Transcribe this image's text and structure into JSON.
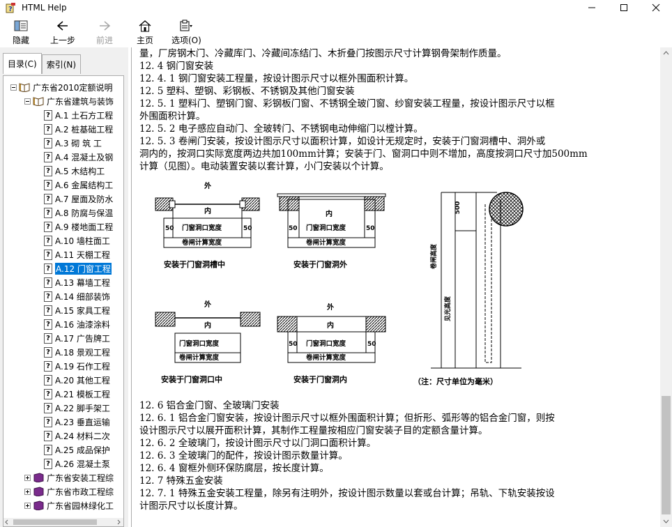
{
  "window": {
    "title": "HTML Help"
  },
  "toolbar": {
    "hide": "隐藏",
    "back": "上一步",
    "forward": "前进",
    "home": "主页",
    "options": "选项(O)"
  },
  "tabs": {
    "contents": "目录(C)",
    "index": "索引(N)"
  },
  "tree": {
    "root": "广东省2010定额说明",
    "building": "广东省建筑与装饰",
    "items": [
      "A.1  土石方工程",
      "A.2  桩基础工程",
      "A.3  砌 筑 工",
      "A.4  混凝土及钢",
      "A.5  木结构工",
      "A.6  金属结构工",
      "A.7  屋面及防水",
      "A.8  防腐与保温",
      "A.9  楼地面工程",
      "A.10  墙柱面工",
      "A.11  天棚工程",
      "A.12  门窗工程",
      "A.13  幕墙工程",
      "A.14  细部装饰",
      "A.15  家具工程",
      "A.16  油漆涂料",
      "A.17  广告牌工",
      "A.18  景观工程",
      "A.19  石作工程",
      "A.20  其他工程",
      "A.21  模板工程",
      "A.22  脚手架工",
      "A.23  垂直运输",
      "A.24  材料二次",
      "A.25  成品保护",
      "A.26  混凝土泵"
    ],
    "others": [
      "广东省安装工程综",
      "广东省市政工程综",
      "广东省园林绿化工"
    ]
  },
  "content": {
    "top_lines": [
      "量，厂房钢木门、冷藏库门、冷藏间冻结门、木折叠门按图示尺寸计算钢骨架制作质量。",
      "12. 4  钢门窗安装",
      "12. 4. 1  钢门窗安装工程量，按设计图示尺寸以框外围面积计算。",
      "12. 5  塑料、塑钢、彩钢板、不锈钢及其他门窗安装",
      "12. 5. 1  塑料门、塑钢门窗、彩钢板门窗、不锈钢全玻门窗、纱窗安装工程量，按设计图示尺寸以框",
      "外围面积计算。",
      "12. 5. 2  电子感应自动门、全玻转门、不锈钢电动伸缩门以樘计算。",
      "12. 5. 3  卷闸门安装，按设计图示尺寸以面积计算，如设计无规定时，安装于门窗洞槽中、洞外或",
      "洞内的，按洞口实际宽度两边共加100mm计算；安装于门、窗洞口中则不增加，高度按洞口尺寸加500mm",
      "计算（见图）。电动装置安装以套计算，小门安装以个计算。"
    ],
    "bottom_lines": [
      "12. 6  铝合金门窗、全玻璃门安装",
      "12. 6. 1  铝合金门窗安装，按设计图示尺寸以框外围面积计算；但折形、弧形等的铝合金门窗，则按",
      "设计图示尺寸以展开面积计算，其制作工程量按相应门窗安装子目的定额含量计算。",
      "12. 6. 2  全玻璃门，按设计图示尺寸以门洞口面积计算。",
      "12. 6. 3  全玻璃门的配件，按设计图示数量计算。",
      "12. 6. 4  窗框外侧环保防腐层，按长度计算。",
      "12. 7  特殊五金安装",
      "12. 7. 1  特殊五金安装工程量，除另有注明外，按设计图示数量以套或台计算；吊轨、下轨安装按设",
      "计图示尺寸以长度计算。"
    ]
  },
  "diagram": {
    "outside": "外",
    "inside": "内",
    "offset": "50",
    "opening_width": "门窗洞口宽度",
    "shutter_width": "卷闸计算宽度",
    "cap_groove": "安装于门窗洞槽中",
    "cap_outside": "安装于门窗洞外",
    "cap_in_opening": "安装于门窗洞口中",
    "cap_inside": "安装于门窗洞内",
    "height_shutter": "卷闸高度",
    "height_clear": "见光高度",
    "dim_500": "500",
    "note": "（注：尺寸单位为毫米）"
  }
}
